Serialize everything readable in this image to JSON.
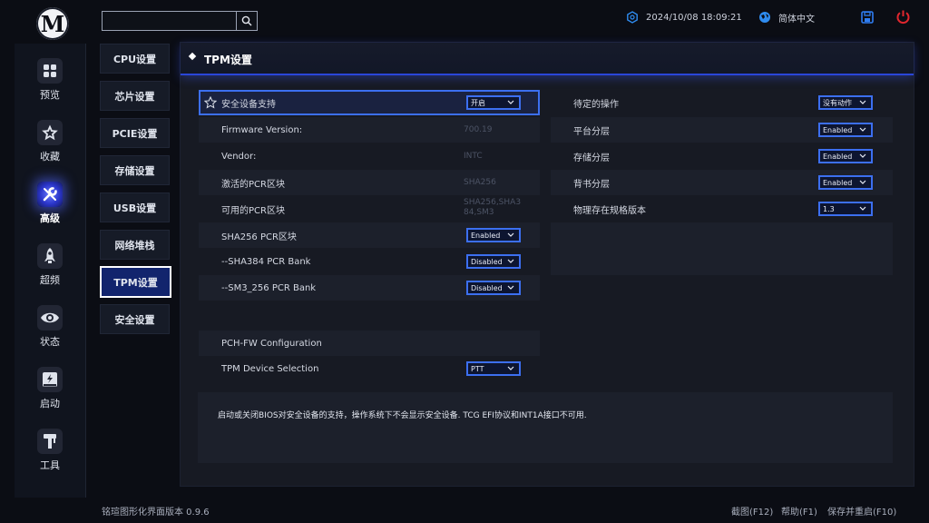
{
  "topbar": {
    "search_placeholder": "",
    "datetime": "2024/10/08 18:09:21",
    "language": "简体中文"
  },
  "sidebar": {
    "items": [
      {
        "label": "预览",
        "icon": "grid-icon"
      },
      {
        "label": "收藏",
        "icon": "star-icon"
      },
      {
        "label": "高级",
        "icon": "wrench-icon",
        "active": true
      },
      {
        "label": "超频",
        "icon": "rocket-icon"
      },
      {
        "label": "状态",
        "icon": "eye-icon"
      },
      {
        "label": "启动",
        "icon": "ssd-icon"
      },
      {
        "label": "工具",
        "icon": "tool-icon"
      }
    ]
  },
  "categories": [
    {
      "label": "CPU设置"
    },
    {
      "label": "芯片设置"
    },
    {
      "label": "PCIE设置"
    },
    {
      "label": "存储设置"
    },
    {
      "label": "USB设置"
    },
    {
      "label": "网络堆栈"
    },
    {
      "label": "TPM设置",
      "active": true
    },
    {
      "label": "安全设置"
    }
  ],
  "panel": {
    "title": "TPM设置",
    "left_rows": [
      {
        "label": "安全设备支持",
        "select": "开启"
      },
      {
        "label": "Firmware Version:",
        "value": "700.19"
      },
      {
        "label": "Vendor:",
        "value": "INTC"
      },
      {
        "label": "激活的PCR区块",
        "value": "SHA256"
      },
      {
        "label": "可用的PCR区块",
        "value": "SHA256,SHA384,SM3"
      },
      {
        "label": "SHA256 PCR区块",
        "select": "Enabled"
      },
      {
        "label": "--SHA384 PCR Bank",
        "select": "Disabled"
      },
      {
        "label": "--SM3_256 PCR Bank",
        "select": "Disabled"
      }
    ],
    "left_rows2": [
      {
        "label": "PCH-FW Configuration"
      },
      {
        "label": "TPM Device Selection",
        "select": "PTT"
      }
    ],
    "right_rows": [
      {
        "label": "待定的操作",
        "select": "没有动作"
      },
      {
        "label": "平台分层",
        "select": "Enabled"
      },
      {
        "label": "存储分层",
        "select": "Enabled"
      },
      {
        "label": "背书分层",
        "select": "Enabled"
      },
      {
        "label": "物理存在规格版本",
        "select": "1.3"
      }
    ],
    "description": "启动或关闭BIOS对安全设备的支持，操作系统下不会显示安全设备. TCG EFI协议和INT1A接口不可用."
  },
  "footer": {
    "version": "铭瑄图形化界面版本 0.9.6",
    "screenshot": "截图(F12)",
    "help": "帮助(F1)",
    "save_reboot": "保存并重启(F10)"
  },
  "colors": {
    "accent": "#3c6ff0",
    "active_tab_bg": "#12246d",
    "power_red": "#e0262e",
    "save_blue": "#2f7df2"
  }
}
